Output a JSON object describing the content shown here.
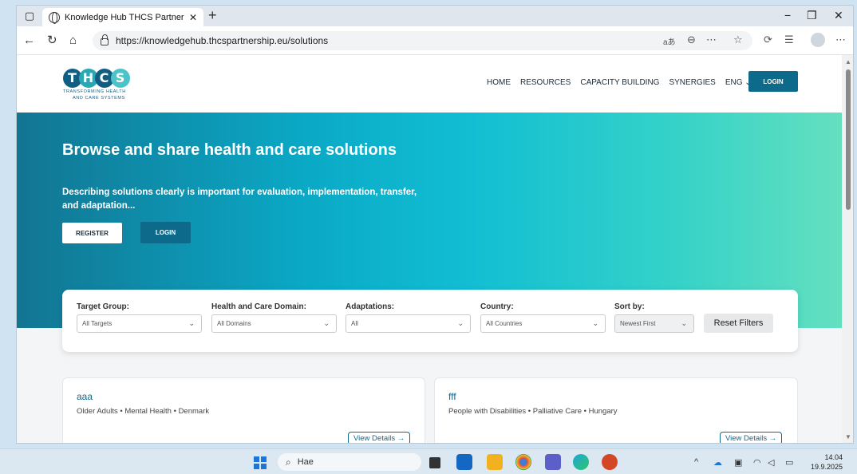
{
  "browser": {
    "tab_title": "Knowledge Hub THCS Partnership",
    "tab_close": "✕",
    "new_tab": "+",
    "url": "https://knowledgehub.thcspartnership.eu/solutions",
    "read_aloud": "aあ",
    "window_controls": {
      "minimize": "−",
      "restore": "❐",
      "close": "✕"
    }
  },
  "site": {
    "logo_text": "THCS",
    "logo_tagline_1": "Transforming Health",
    "logo_tagline_2": "and Care Systems",
    "nav": [
      "HOME",
      "RESOURCES",
      "CAPACITY BUILDING",
      "SYNERGIES",
      "ENG ⌄"
    ],
    "login_label": "LOGIN"
  },
  "hero": {
    "title": "Browse and share health and care solutions",
    "subtitle": "Describing solutions clearly is important for evaluation, implementation, transfer, and adaptation...",
    "register_label": "REGISTER",
    "login_label": "LOGIN"
  },
  "filters": {
    "target_group": {
      "label": "Target Group:",
      "value": "All Targets"
    },
    "domain": {
      "label": "Health and Care Domain:",
      "value": "All Domains"
    },
    "adaptations": {
      "label": "Adaptations:",
      "value": "All"
    },
    "country": {
      "label": "Country:",
      "value": "All Countries"
    },
    "sort": {
      "label": "Sort by:",
      "value": "Newest First"
    },
    "reset_label": "Reset Filters"
  },
  "cards": [
    {
      "title": "aaa",
      "meta": "Older Adults • Mental Health • Denmark",
      "link": "View Details →"
    },
    {
      "title": "fff",
      "meta": "People with Disabilities • Palliative Care • Hungary",
      "link": "View Details →"
    }
  ],
  "taskbar": {
    "search_text": "Hae",
    "time": "14.04",
    "date": "19.9.2025"
  },
  "colors": {
    "brand": "#0d6a8a",
    "hero_start": "#127592",
    "hero_end": "#64e0bf"
  }
}
